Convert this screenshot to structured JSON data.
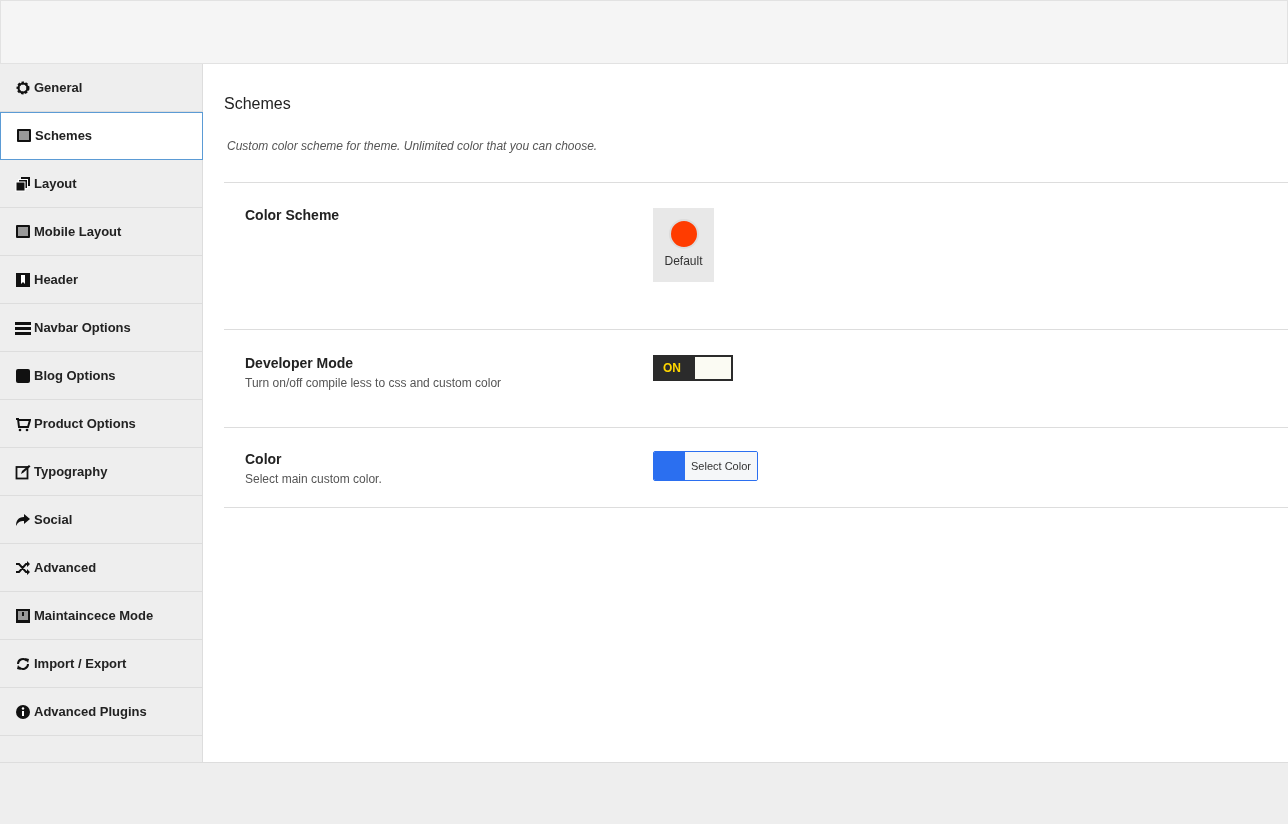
{
  "sidebar": {
    "items": [
      {
        "label": "General",
        "selected": false
      },
      {
        "label": "Schemes",
        "selected": true
      },
      {
        "label": "Layout",
        "selected": false
      },
      {
        "label": "Mobile Layout",
        "selected": false
      },
      {
        "label": "Header",
        "selected": false
      },
      {
        "label": "Navbar Options",
        "selected": false
      },
      {
        "label": "Blog Options",
        "selected": false
      },
      {
        "label": "Product Options",
        "selected": false
      },
      {
        "label": "Typography",
        "selected": false
      },
      {
        "label": "Social",
        "selected": false
      },
      {
        "label": "Advanced",
        "selected": false
      },
      {
        "label": "Maintaincece Mode",
        "selected": false
      },
      {
        "label": "Import / Export",
        "selected": false
      },
      {
        "label": "Advanced Plugins",
        "selected": false
      }
    ]
  },
  "section": {
    "title": "Schemes",
    "description": "Custom color scheme for theme. Unlimited color that you can choose.",
    "fields": [
      {
        "kind": "schemes",
        "label": "Color Scheme",
        "options": [
          {
            "label": "Default",
            "color": "#ff3c00",
            "selected": true
          }
        ]
      },
      {
        "kind": "switch",
        "label": "Developer Mode",
        "help": "Turn on/off compile less to css and custom color",
        "on_label": "ON",
        "on": true
      },
      {
        "kind": "colorpicker",
        "label": "Color",
        "help": "Select main custom color.",
        "button": "Select Color",
        "color": "#2b6ff0"
      }
    ]
  }
}
